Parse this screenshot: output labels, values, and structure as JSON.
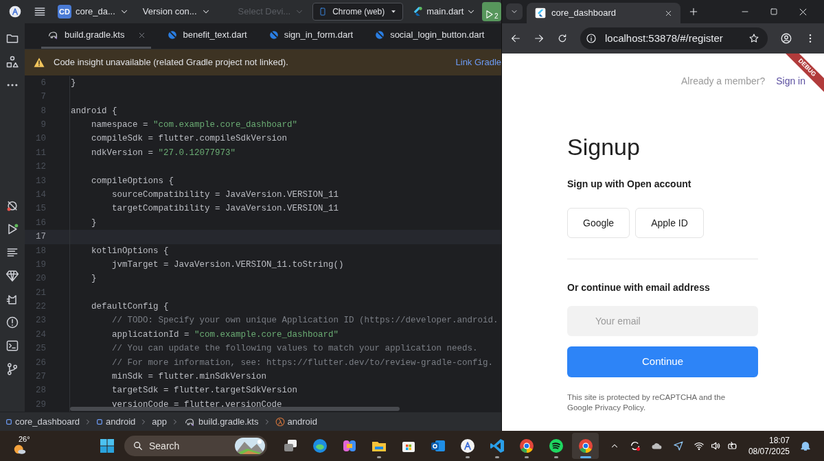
{
  "ide": {
    "toolbar": {
      "project_badge": "CD",
      "project": "core_da...",
      "vcs": "Version con...",
      "device_placeholder": "Select Devi...",
      "target": "Chrome (web)",
      "run_config": "main.dart",
      "run_badge": "2"
    },
    "tabs": [
      {
        "label": "build.gradle.kts",
        "kind": "gradle",
        "selected": true
      },
      {
        "label": "benefit_text.dart",
        "kind": "dart",
        "selected": false
      },
      {
        "label": "sign_in_form.dart",
        "kind": "dart",
        "selected": false
      },
      {
        "label": "social_login_button.dart",
        "kind": "dart",
        "selected": false
      }
    ],
    "banner": {
      "message": "Code insight unavailable (related Gradle project not linked).",
      "action": "Link Gradle"
    },
    "lines": [
      {
        "number": "6",
        "current": false,
        "segments": [
          {
            "kind": "plain",
            "text": "}"
          }
        ]
      },
      {
        "number": "7",
        "current": false
      },
      {
        "number": "8",
        "current": false,
        "segments": [
          {
            "kind": "plain",
            "text": "android {"
          }
        ]
      },
      {
        "number": "9",
        "current": false,
        "segments": [
          {
            "kind": "plain",
            "text": "    namespace = "
          },
          {
            "kind": "string",
            "text": "\"com.example.core_dashboard\""
          }
        ]
      },
      {
        "number": "10",
        "current": false,
        "segments": [
          {
            "kind": "plain",
            "text": "    compileSdk = flutter.compileSdkVersion"
          }
        ]
      },
      {
        "number": "11",
        "current": false,
        "segments": [
          {
            "kind": "plain",
            "text": "    ndkVersion = "
          },
          {
            "kind": "string",
            "text": "\"27.0.12077973\""
          }
        ]
      },
      {
        "number": "12",
        "current": false
      },
      {
        "number": "13",
        "current": false,
        "segments": [
          {
            "kind": "plain",
            "text": "    compileOptions {"
          }
        ]
      },
      {
        "number": "14",
        "current": false,
        "segments": [
          {
            "kind": "plain",
            "text": "        sourceCompatibility = JavaVersion.VERSION_11"
          }
        ]
      },
      {
        "number": "15",
        "current": false,
        "segments": [
          {
            "kind": "plain",
            "text": "        targetCompatibility = JavaVersion.VERSION_11"
          }
        ]
      },
      {
        "number": "16",
        "current": false,
        "segments": [
          {
            "kind": "plain",
            "text": "    }"
          }
        ]
      },
      {
        "number": "17",
        "current": true
      },
      {
        "number": "18",
        "current": false,
        "segments": [
          {
            "kind": "plain",
            "text": "    kotlinOptions {"
          }
        ]
      },
      {
        "number": "19",
        "current": false,
        "segments": [
          {
            "kind": "plain",
            "text": "        jvmTarget = JavaVersion.VERSION_11.toString()"
          }
        ]
      },
      {
        "number": "20",
        "current": false,
        "segments": [
          {
            "kind": "plain",
            "text": "    }"
          }
        ]
      },
      {
        "number": "21",
        "current": false
      },
      {
        "number": "22",
        "current": false,
        "segments": [
          {
            "kind": "plain",
            "text": "    defaultConfig {"
          }
        ]
      },
      {
        "number": "23",
        "current": false,
        "segments": [
          {
            "kind": "comment",
            "text": "        // TODO: Specify your own unique Application ID (https://developer.android."
          }
        ]
      },
      {
        "number": "24",
        "current": false,
        "segments": [
          {
            "kind": "plain",
            "text": "        applicationId = "
          },
          {
            "kind": "string",
            "text": "\"com.example.core_dashboard\""
          }
        ]
      },
      {
        "number": "25",
        "current": false,
        "segments": [
          {
            "kind": "comment",
            "text": "        // You can update the following values to match your application needs."
          }
        ]
      },
      {
        "number": "26",
        "current": false,
        "segments": [
          {
            "kind": "comment",
            "text": "        // For more information, see: https://flutter.dev/to/review-gradle-config."
          }
        ]
      },
      {
        "number": "27",
        "current": false,
        "segments": [
          {
            "kind": "plain",
            "text": "        minSdk = flutter.minSdkVersion"
          }
        ]
      },
      {
        "number": "28",
        "current": false,
        "segments": [
          {
            "kind": "plain",
            "text": "        targetSdk = flutter.targetSdkVersion"
          }
        ]
      },
      {
        "number": "29",
        "current": false,
        "segments": [
          {
            "kind": "plain",
            "text": "        versionCode = flutter.versionCode"
          }
        ]
      }
    ],
    "breadcrumb": [
      {
        "label": "core_dashboard",
        "kind": "module"
      },
      {
        "label": "android",
        "kind": "module"
      },
      {
        "label": "app",
        "kind": "folder"
      },
      {
        "label": "build.gradle.kts",
        "kind": "gradle"
      },
      {
        "label": "android",
        "kind": "lambda"
      }
    ]
  },
  "browser": {
    "tab_title": "core_dashboard",
    "url": "localhost:53878/#/register",
    "page": {
      "debug_banner": "DEBUG",
      "member_prompt": "Already a member?",
      "sign_in": "Sign in",
      "title": "Signup",
      "social_heading": "Sign up with Open account",
      "social_buttons": [
        "Google",
        "Apple ID"
      ],
      "email_heading": "Or continue with email address",
      "email": {
        "placeholder": "Your email"
      },
      "continue": "Continue",
      "footer": "This site is protected by reCAPTCHA and the Google Privacy Policy."
    }
  },
  "taskbar": {
    "temperature": "26°",
    "search": {
      "placeholder": "Search"
    },
    "apps": [
      {
        "kind": "taskview",
        "running": false,
        "active": false
      },
      {
        "kind": "edge",
        "running": false,
        "active": false
      },
      {
        "kind": "copilot",
        "running": false,
        "active": false
      },
      {
        "kind": "explorer",
        "running": true,
        "active": false
      },
      {
        "kind": "store",
        "running": false,
        "active": false
      },
      {
        "kind": "outlook",
        "running": false,
        "active": false
      },
      {
        "kind": "studio",
        "running": true,
        "active": false
      },
      {
        "kind": "vscode",
        "running": true,
        "active": false
      },
      {
        "kind": "chrome",
        "running": true,
        "active": false
      },
      {
        "kind": "spotify",
        "running": true,
        "active": false
      },
      {
        "kind": "chrome",
        "running": true,
        "active": true
      }
    ],
    "time": "18:07",
    "date": "08/07/2025"
  }
}
